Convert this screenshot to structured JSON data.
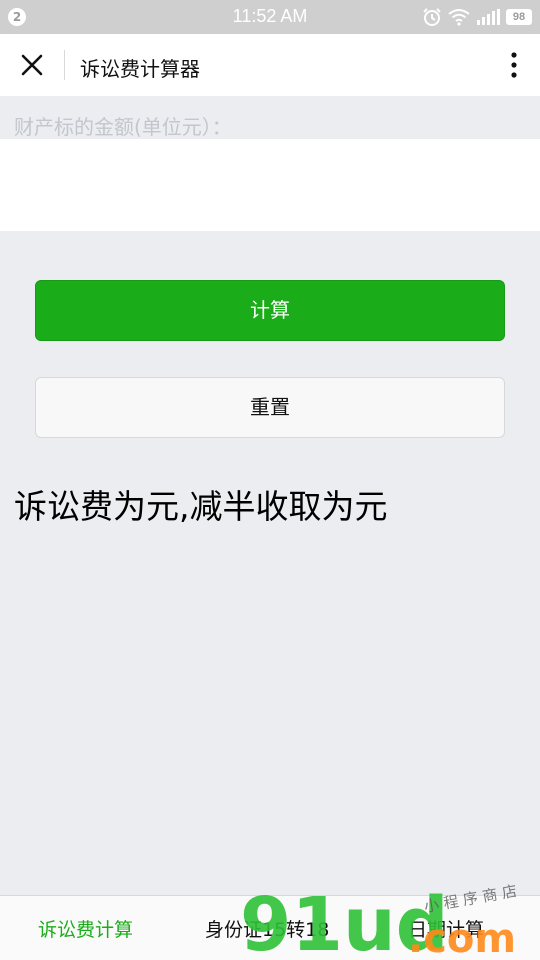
{
  "status_bar": {
    "notification_count": "2",
    "time": "11:52 AM",
    "battery": "98",
    "icons": [
      "alarm-icon",
      "wifi-icon",
      "signal-icon",
      "battery-icon"
    ]
  },
  "header": {
    "title": "诉讼费计算器",
    "close_icon": "close-icon",
    "more_icon": "more-vertical-icon"
  },
  "form": {
    "amount_label": "财产标的金额(单位元）：",
    "amount_value": ""
  },
  "buttons": {
    "calculate": "计算",
    "reset": "重置"
  },
  "result": {
    "text": "诉讼费为元,减半收取为元"
  },
  "tabs": [
    {
      "label": "诉讼费计算",
      "active": true
    },
    {
      "label": "身份证15转18",
      "active": false
    },
    {
      "label": "日期计算",
      "active": false
    }
  ],
  "watermark": {
    "text": "91ud.com",
    "subtext": "小程序商店"
  },
  "colors": {
    "accent": "#1aad19",
    "background": "#ebedf1"
  }
}
